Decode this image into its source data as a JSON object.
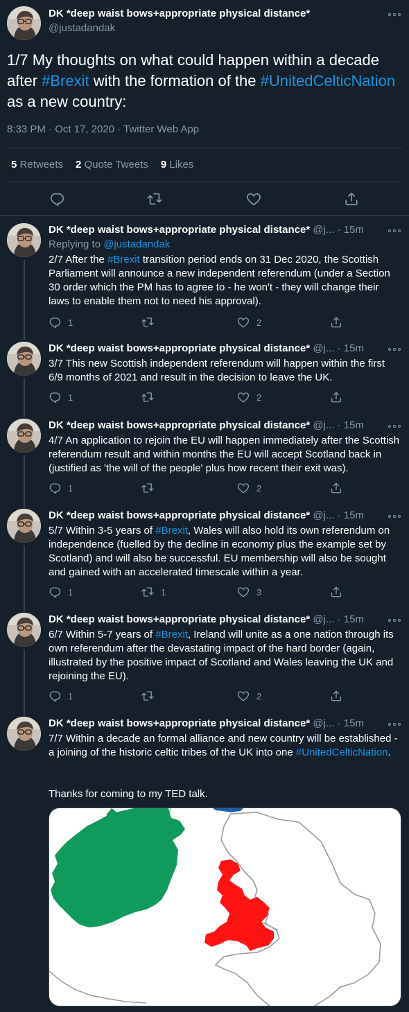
{
  "main": {
    "name": "DK *deep waist bows+appropriate physical distance*",
    "handle": "@justadandak",
    "text_p1": "1/7 My thoughts on what could happen within a decade after ",
    "tag1": "#Brexit",
    "text_p2": " with the formation of the ",
    "tag2": "#UnitedCelticNation",
    "text_p3": " as a new country:",
    "meta": "8:33 PM · Oct 17, 2020 · Twitter Web App",
    "retweets_count": "5",
    "retweets_label": "Retweets",
    "quotes_count": "2",
    "quotes_label": "Quote Tweets",
    "likes_count": "9",
    "likes_label": "Likes"
  },
  "reply_header": {
    "name": "DK *deep waist bows+appropriate physical distance*",
    "handle": "@j...",
    "sep": "·",
    "time": "15m"
  },
  "replies": [
    {
      "replying_label": "Replying to ",
      "replying_handle": "@justadandak",
      "p1": "2/7 After the ",
      "tag": "#Brexit",
      "p2": " transition period ends on 31 Dec 2020, the Scottish Parliament will announce a new independent referendum (under a Section 30 order which the PM has to agree to - he won't - they will change their laws to enable them not to need his approval).",
      "replies": "1",
      "retweets": "",
      "likes": "2"
    },
    {
      "p1": "3/7 This new Scottish independent referendum will happen within the first 6/9 months of 2021 and result in the decision to leave the UK.",
      "replies": "1",
      "retweets": "",
      "likes": "2"
    },
    {
      "p1": "4/7 An application to rejoin the EU will happen immediately after the Scottish referendum result and within months the EU will accept Scotland back in (justified as 'the will of the people' plus how recent their exit was).",
      "replies": "1",
      "retweets": "",
      "likes": "2"
    },
    {
      "p1": "5/7 Within 3-5 years of ",
      "tag": "#Brexit",
      "p2": ", Wales will also hold its own referendum on independence (fuelled by the decline in economy plus the example set by Scotland) and will also be successful. EU membership will also be sought and gained with an accelerated timescale within a year.",
      "replies": "1",
      "retweets": "1",
      "likes": "3"
    },
    {
      "p1": "6/7 Within 5-7 years of ",
      "tag": "#Brexit",
      "p2": ", Ireland will unite as a one nation through its own referendum after the devastating impact of the hard border (again, illustrated by the positive impact of Scotland and Wales leaving the UK and rejoining the EU).",
      "replies": "1",
      "retweets": "",
      "likes": "2"
    },
    {
      "p1": "7/7 Within a decade an formal alliance and new country will be established - a joining of the historic celtic tribes of the UK into one ",
      "tag": "#UnitedCelticNation",
      "p2": ".",
      "p3": "Thanks for coming to my TED talk."
    }
  ],
  "icons": [
    "reply-icon",
    "retweet-icon",
    "like-icon",
    "share-icon",
    "more-icon"
  ],
  "colors": {
    "background": "#15202b",
    "link": "#1b95e0",
    "secondary_text": "#8899a6",
    "divider": "#38444d",
    "map_ireland": "#109a5c",
    "map_wales": "#ff0000",
    "map_scotland": "#1d5fa8"
  }
}
